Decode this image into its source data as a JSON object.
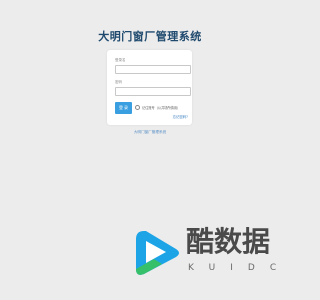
{
  "app": {
    "title": "大明门窗厂管理系统"
  },
  "login": {
    "username_label": "登录名",
    "username_value": "",
    "password_label": "密码",
    "password_value": "",
    "submit_label": "登 录",
    "remember_label": "记住账号（公共场所慎用）",
    "forgot_label": "忘记密码?"
  },
  "footer": {
    "text": "大明门窗厂管理系统"
  },
  "watermark": {
    "brand": "酷数据",
    "sub": "KUIDC"
  },
  "colors": {
    "accent": "#3a9fe0",
    "title": "#1f4a6e",
    "background": "#ececec"
  }
}
